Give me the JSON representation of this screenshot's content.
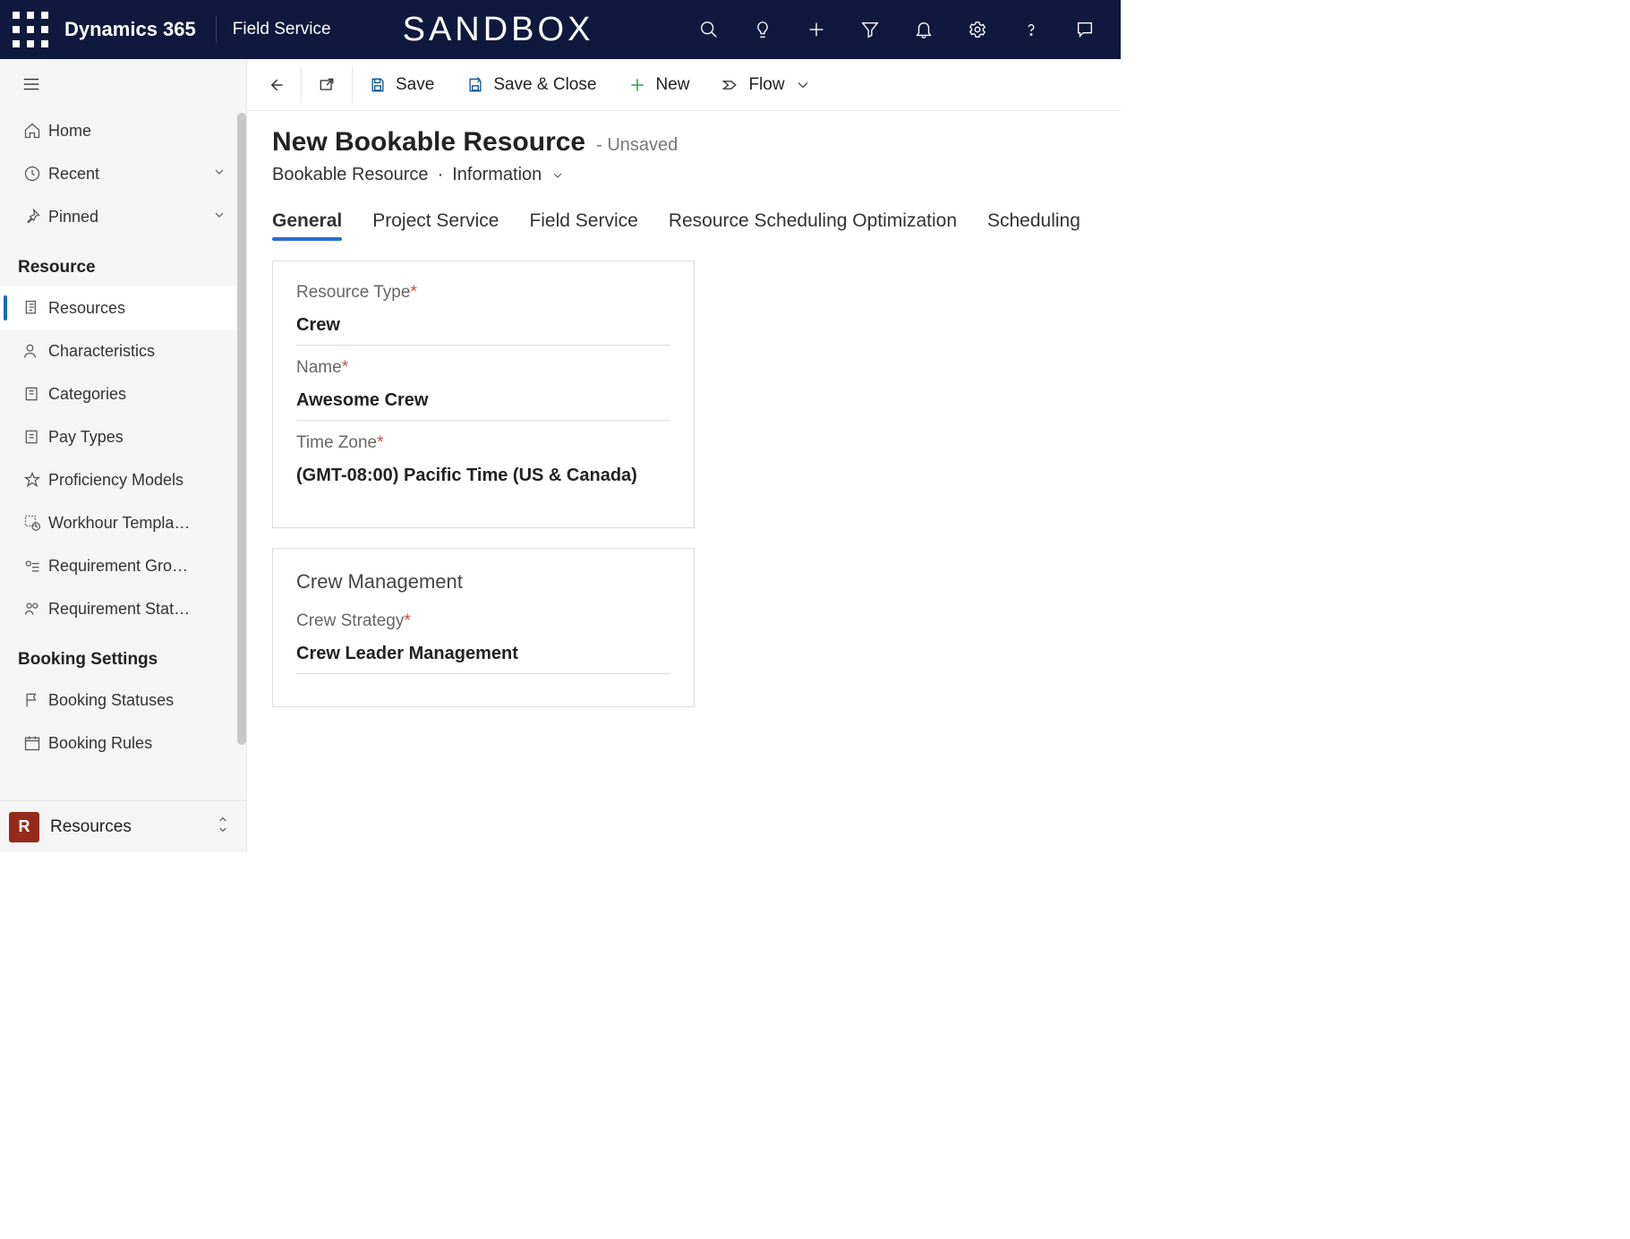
{
  "header": {
    "brand": "Dynamics 365",
    "app_name": "Field Service",
    "environment": "SANDBOX"
  },
  "sidebar": {
    "top": [
      {
        "label": "Home",
        "icon": "home-icon"
      },
      {
        "label": "Recent",
        "icon": "clock-icon",
        "expandable": true
      },
      {
        "label": "Pinned",
        "icon": "pin-icon",
        "expandable": true
      }
    ],
    "groups": [
      {
        "title": "Resource",
        "items": [
          {
            "label": "Resources",
            "icon": "resource-icon",
            "selected": true
          },
          {
            "label": "Characteristics",
            "icon": "person-icon"
          },
          {
            "label": "Categories",
            "icon": "category-icon"
          },
          {
            "label": "Pay Types",
            "icon": "paytype-icon"
          },
          {
            "label": "Proficiency Models",
            "icon": "star-icon"
          },
          {
            "label": "Workhour Templa…",
            "icon": "workhour-icon"
          },
          {
            "label": "Requirement Gro…",
            "icon": "reqgroup-icon"
          },
          {
            "label": "Requirement Stat…",
            "icon": "reqstatus-icon"
          }
        ]
      },
      {
        "title": "Booking Settings",
        "items": [
          {
            "label": "Booking Statuses",
            "icon": "flag-icon"
          },
          {
            "label": "Booking Rules",
            "icon": "calendar-icon"
          }
        ]
      }
    ],
    "area": {
      "badge": "R",
      "label": "Resources"
    }
  },
  "commands": {
    "save": "Save",
    "save_close": "Save & Close",
    "new": "New",
    "flow": "Flow"
  },
  "page": {
    "title": "New Bookable Resource",
    "status": "- Unsaved",
    "entity": "Bookable Resource",
    "form": "Information"
  },
  "tabs": [
    "General",
    "Project Service",
    "Field Service",
    "Resource Scheduling Optimization",
    "Scheduling"
  ],
  "active_tab": 0,
  "form": {
    "general": {
      "resource_type": {
        "label": "Resource Type",
        "value": "Crew",
        "required": true
      },
      "name": {
        "label": "Name",
        "value": "Awesome Crew",
        "required": true
      },
      "time_zone": {
        "label": "Time Zone",
        "value": "(GMT-08:00) Pacific Time (US & Canada)",
        "required": true
      }
    },
    "crew_mgmt": {
      "title": "Crew Management",
      "crew_strategy": {
        "label": "Crew Strategy",
        "value": "Crew Leader Management",
        "required": true
      }
    }
  }
}
